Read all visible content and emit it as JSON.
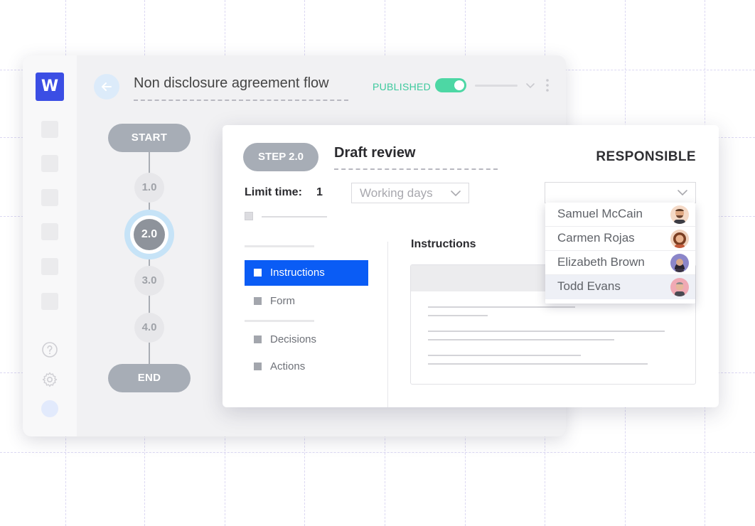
{
  "app": {
    "logo_letter": "W",
    "flow_title": "Non disclosure agreement flow",
    "status_label": "PUBLISHED",
    "status_color": "#3cc99c",
    "toggle_on": true
  },
  "timeline": {
    "start_label": "START",
    "end_label": "END",
    "steps": [
      "1.0",
      "2.0",
      "3.0",
      "4.0"
    ],
    "active_step": "2.0"
  },
  "step_card": {
    "step_label": "STEP 2.0",
    "title": "Draft review",
    "responsible_label": "RESPONSIBLE",
    "limit_time_label": "Limit time:",
    "limit_time_value": "1",
    "unit_select_value": "Working days",
    "nav": {
      "items": [
        "Instructions",
        "Form",
        "Decisions",
        "Actions"
      ],
      "active": "Instructions"
    },
    "content_heading": "Instructions"
  },
  "responsible_dropdown": {
    "options": [
      "Samuel McCain",
      "Carmen Rojas",
      "Elizabeth Brown",
      "Todd Evans"
    ],
    "highlighted": "Todd Evans"
  },
  "colors": {
    "brand": "#3b4ee4",
    "active_nav": "#0a5cf5",
    "active_ring": "#c6e3f7"
  }
}
